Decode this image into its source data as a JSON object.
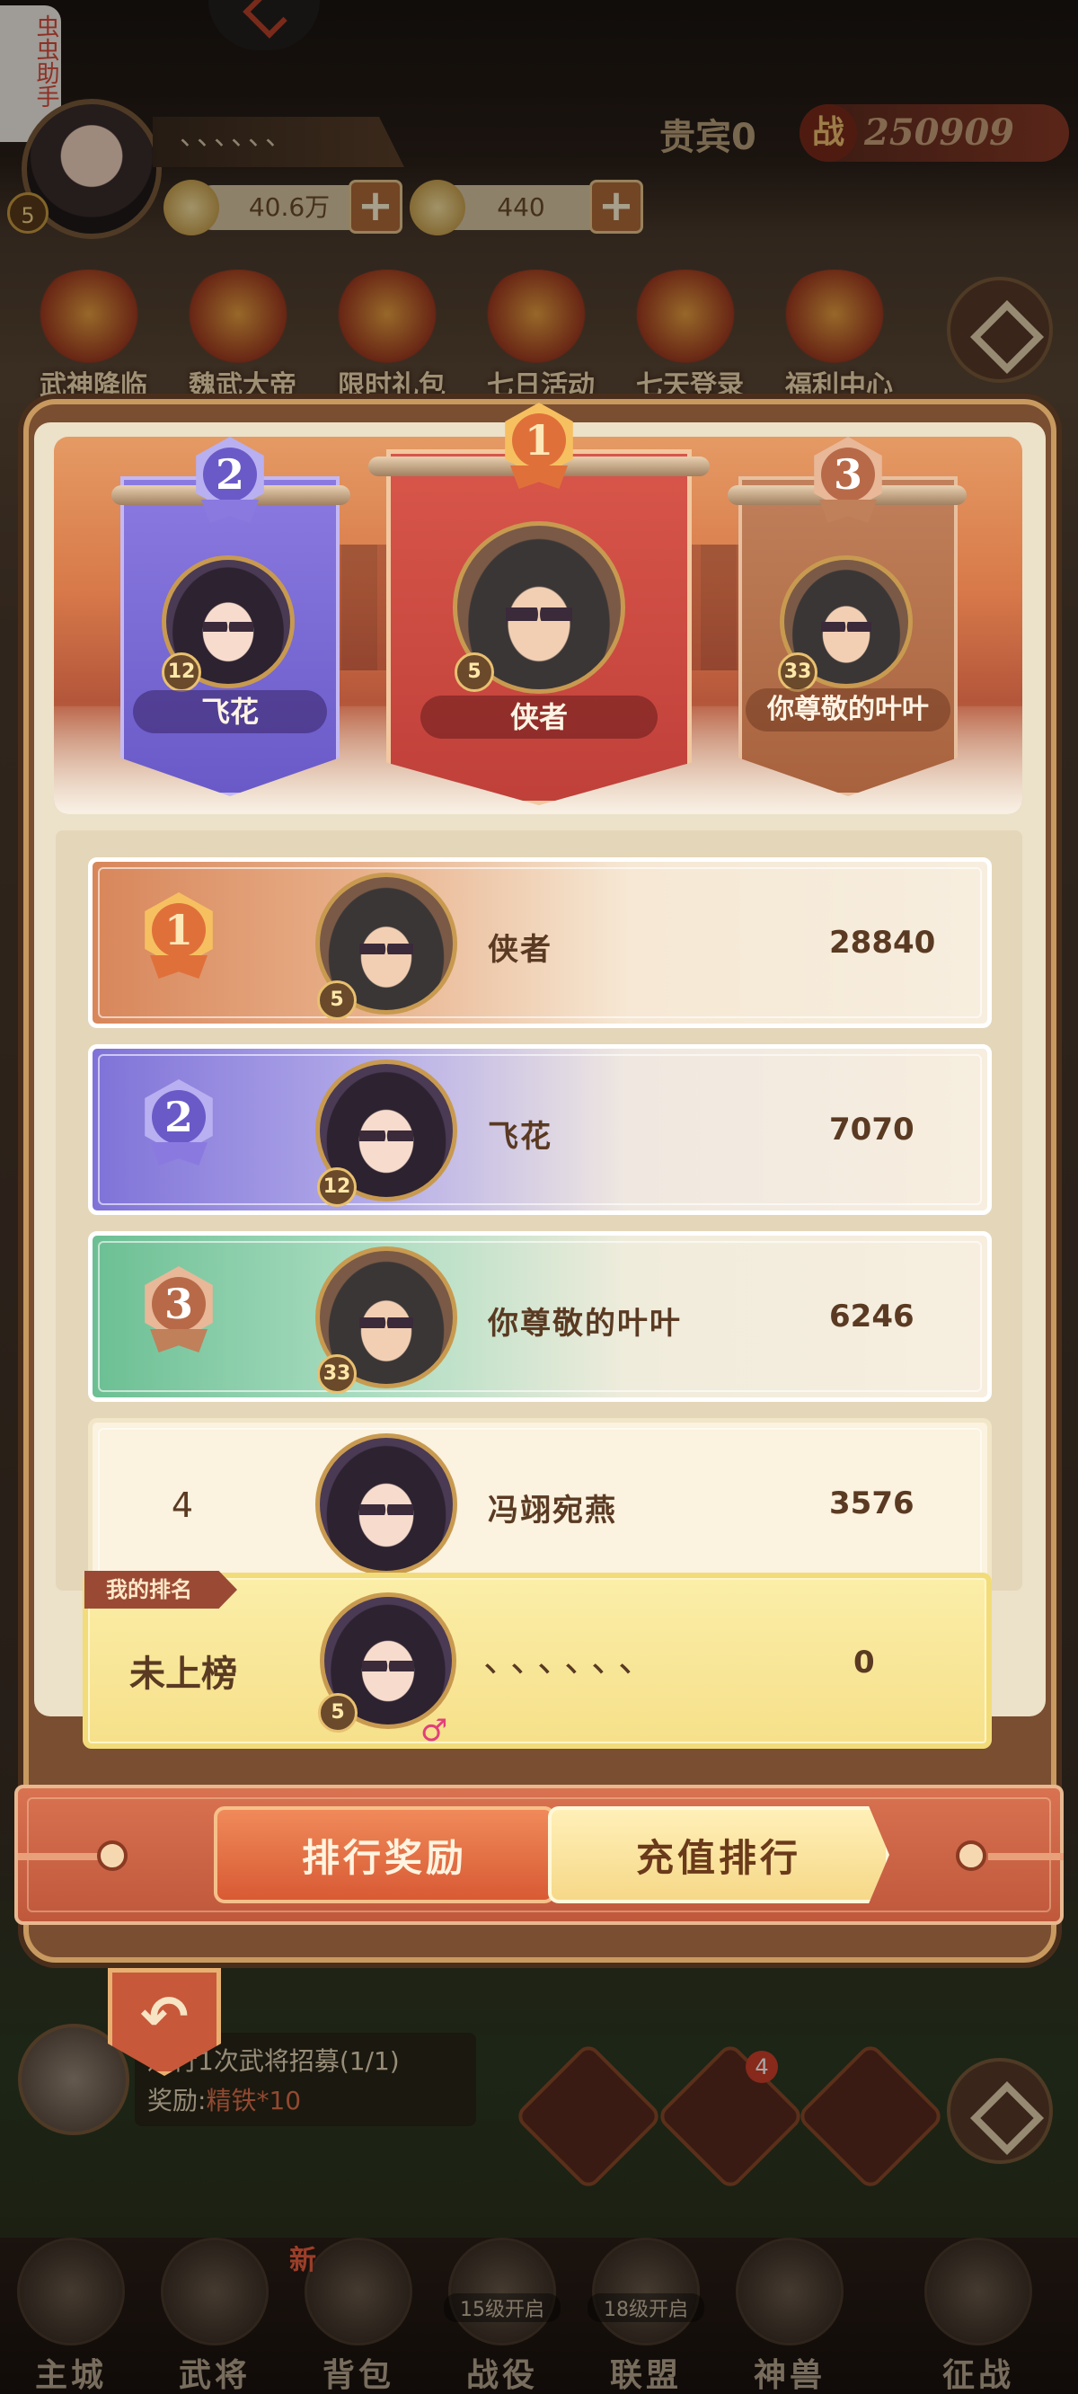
{
  "assist_tab": "虫虫助手",
  "player": {
    "name_dots": "、、、、、、",
    "avatar_level": "5",
    "vip": "贵宾0",
    "power_icon": "战",
    "power": "250909",
    "silver": "40.6万",
    "gold": "440"
  },
  "events": [
    "武神降临",
    "魏武大帝",
    "限时礼包",
    "七日活动",
    "七天登录",
    "福利中心"
  ],
  "podium": [
    {
      "rank": "2",
      "name": "飞花",
      "level": "12",
      "gender": "female"
    },
    {
      "rank": "1",
      "name": "侠者",
      "level": "5",
      "gender": "male"
    },
    {
      "rank": "3",
      "name": "你尊敬的叶叶",
      "level": "33",
      "gender": "male"
    }
  ],
  "ranking": [
    {
      "rank": "1",
      "name": "侠者",
      "score": "28840",
      "level": "5"
    },
    {
      "rank": "2",
      "name": "飞花",
      "score": "7070",
      "level": "12"
    },
    {
      "rank": "3",
      "name": "你尊敬的叶叶",
      "score": "6246",
      "level": "33"
    },
    {
      "rank": "4",
      "name": "冯翊宛燕",
      "score": "3576",
      "level": ""
    }
  ],
  "my_rank": {
    "tag": "我的排名",
    "status": "未上榜",
    "name": "、、、、、、",
    "score": "0",
    "level": "5",
    "gender_symbol": "♂"
  },
  "tabs": {
    "reward": "排行奖励",
    "recharge": "充值排行"
  },
  "back_icon": "back-arrow-icon",
  "quest": {
    "title": "进行1次武将招募(1/1)",
    "reward_label": "奖励:",
    "reward_value": "精铁*10"
  },
  "mail_badge": "4",
  "bottom_nav": {
    "items": [
      {
        "label": "主城",
        "lock": ""
      },
      {
        "label": "武将",
        "lock": ""
      },
      {
        "label": "背包",
        "lock": ""
      },
      {
        "label": "战役",
        "lock": "15级开启"
      },
      {
        "label": "联盟",
        "lock": "18级开启"
      },
      {
        "label": "神兽",
        "lock": ""
      },
      {
        "label": "征战",
        "lock": ""
      }
    ],
    "new_badge": "新"
  },
  "colors": {
    "rank1": "#d8865a",
    "rank2": "#7f72d8",
    "rank3": "#6bbf93",
    "my_rank_bg": "#fbeea8",
    "tab_active": "#d85a34"
  }
}
